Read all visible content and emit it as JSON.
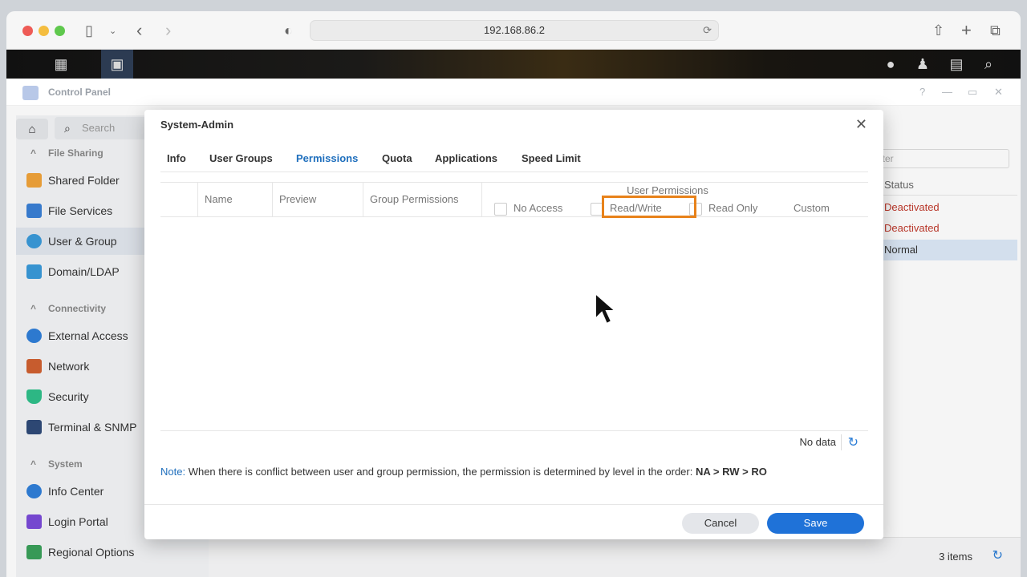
{
  "browser": {
    "url": "192.168.86.2"
  },
  "window": {
    "title": "Control Panel",
    "controls": [
      "?",
      "—",
      "▭",
      "✕"
    ]
  },
  "sidebar": {
    "search_placeholder": "Search",
    "sections": [
      {
        "label": "File Sharing",
        "items": [
          {
            "label": "Shared Folder",
            "icon": "folder-icon",
            "color": "#f0a33a"
          },
          {
            "label": "File Services",
            "icon": "file-services-icon",
            "color": "#3a7fd5"
          },
          {
            "label": "User & Group",
            "icon": "users-icon",
            "color": "#3a9ad9",
            "active": true
          },
          {
            "label": "Domain/LDAP",
            "icon": "domain-icon",
            "color": "#3a9ad9"
          }
        ]
      },
      {
        "label": "Connectivity",
        "items": [
          {
            "label": "External Access",
            "icon": "globe-icon",
            "color": "#2f7ed8"
          },
          {
            "label": "Network",
            "icon": "house-icon",
            "color": "#d06030"
          },
          {
            "label": "Security",
            "icon": "shield-icon",
            "color": "#2fbf8a"
          },
          {
            "label": "Terminal & SNMP",
            "icon": "terminal-icon",
            "color": "#2f4a78"
          }
        ]
      },
      {
        "label": "System",
        "items": [
          {
            "label": "Info Center",
            "icon": "info-icon",
            "color": "#2f7ed8"
          },
          {
            "label": "Login Portal",
            "icon": "portal-icon",
            "color": "#7a4ad8"
          },
          {
            "label": "Regional Options",
            "icon": "region-icon",
            "color": "#3aa05a"
          }
        ]
      }
    ]
  },
  "background_list": {
    "filter_placeholder": "lter",
    "status_header": "Status",
    "statuses": [
      "Deactivated",
      "Deactivated",
      "Normal"
    ],
    "items_count": "3 items"
  },
  "dialog": {
    "title": "System-Admin",
    "tabs": [
      "Info",
      "User Groups",
      "Permissions",
      "Quota",
      "Applications",
      "Speed Limit"
    ],
    "active_tab": "Permissions",
    "columns": [
      "Name",
      "Preview",
      "Group Permissions"
    ],
    "user_permissions": {
      "title": "User Permissions",
      "options": [
        "No Access",
        "Read/Write",
        "Read Only",
        "Custom"
      ]
    },
    "no_data": "No data",
    "note_label": "Note:",
    "note_text": " When there is conflict between user and group permission, the permission is determined by level in the order: ",
    "note_order": "NA > RW > RO",
    "cancel": "Cancel",
    "save": "Save"
  }
}
